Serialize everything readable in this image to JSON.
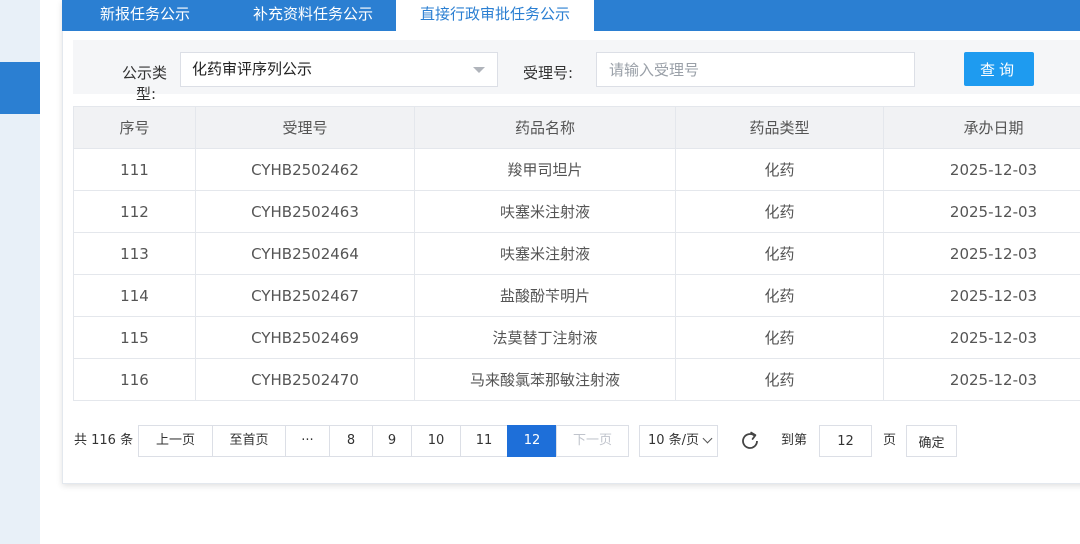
{
  "tabs": [
    {
      "label": "新报任务公示",
      "active": false
    },
    {
      "label": "补充资料任务公示",
      "active": false
    },
    {
      "label": "直接行政审批任务公示",
      "active": true
    }
  ],
  "filter": {
    "type_label_line1": "公示类",
    "type_label_line2": "型:",
    "type_value": "化药审评序列公示",
    "accept_label": "受理号:",
    "accept_placeholder": "请输入受理号",
    "query_button": "查询"
  },
  "table": {
    "columns": [
      "序号",
      "受理号",
      "药品名称",
      "药品类型",
      "承办日期"
    ],
    "rows": [
      {
        "seq": "111",
        "accept_no": "CYHB2502462",
        "drug_name": "羧甲司坦片",
        "drug_type": "化药",
        "date": "2025-12-03"
      },
      {
        "seq": "112",
        "accept_no": "CYHB2502463",
        "drug_name": "呋塞米注射液",
        "drug_type": "化药",
        "date": "2025-12-03"
      },
      {
        "seq": "113",
        "accept_no": "CYHB2502464",
        "drug_name": "呋塞米注射液",
        "drug_type": "化药",
        "date": "2025-12-03"
      },
      {
        "seq": "114",
        "accept_no": "CYHB2502467",
        "drug_name": "盐酸酚苄明片",
        "drug_type": "化药",
        "date": "2025-12-03"
      },
      {
        "seq": "115",
        "accept_no": "CYHB2502469",
        "drug_name": "法莫替丁注射液",
        "drug_type": "化药",
        "date": "2025-12-03"
      },
      {
        "seq": "116",
        "accept_no": "CYHB2502470",
        "drug_name": "马来酸氯苯那敏注射液",
        "drug_type": "化药",
        "date": "2025-12-03"
      }
    ]
  },
  "pagination": {
    "total": "共 116 条",
    "prev": "上一页",
    "first": "至首页",
    "ellipsis": "···",
    "pages": [
      "8",
      "9",
      "10",
      "11",
      "12"
    ],
    "current": "12",
    "next": "下一页",
    "page_size": "10 条/页",
    "goto_prefix": "到第",
    "goto_value": "12",
    "goto_suffix": "页",
    "confirm": "确定"
  },
  "icons": {
    "select_caret": "caret-down-icon",
    "page_size_chevron": "chevron-down-icon",
    "refresh": "refresh-icon"
  },
  "colors": {
    "primary": "#2b7fd2",
    "query_button": "#1e9bf0",
    "active_page": "#1e6fd9"
  }
}
